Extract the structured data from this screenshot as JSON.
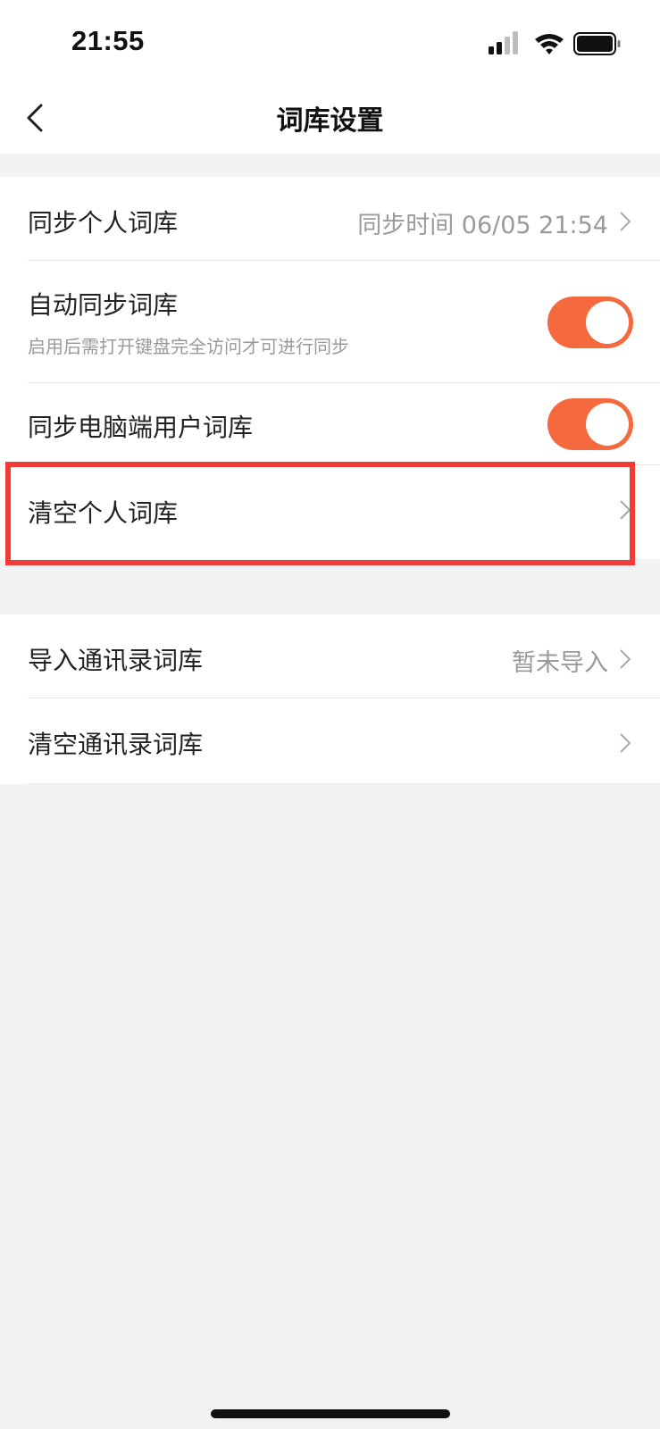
{
  "status_bar": {
    "time": "21:55",
    "icons": [
      "signal-icon",
      "wifi-icon",
      "battery-icon"
    ]
  },
  "nav": {
    "back_icon": "chevron-left-icon",
    "title": "词库设置"
  },
  "groups": [
    {
      "rows": [
        {
          "label": "同步个人词库",
          "value": "同步时间 06/05 21:54",
          "accessory": "chevron-right-icon"
        },
        {
          "label": "自动同步词库",
          "sublabel": "启用后需打开键盘完全访问才可进行同步",
          "toggle_on": true
        },
        {
          "label": "同步电脑端用户词库",
          "toggle_on": true
        },
        {
          "label": "清空个人词库",
          "accessory": "chevron-right-icon",
          "highlighted": true
        }
      ]
    },
    {
      "rows": [
        {
          "label": "导入通讯录词库",
          "value": "暂未导入",
          "accessory": "chevron-right-icon"
        },
        {
          "label": "清空通讯录词库",
          "accessory": "chevron-right-icon"
        }
      ]
    }
  ],
  "colors": {
    "toggle_on": "#f4693d",
    "highlight_border": "#f23b36",
    "background": "#f2f2f5"
  }
}
